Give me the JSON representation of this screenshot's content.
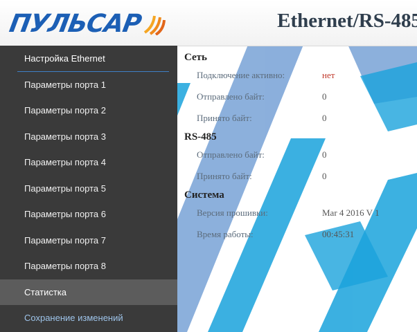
{
  "header": {
    "logo_text": "ПУЛЬСАР",
    "title": "Ethernet/RS-485"
  },
  "sidebar": {
    "items": [
      {
        "label": "Настройка Ethernet"
      },
      {
        "label": "Параметры порта 1"
      },
      {
        "label": "Параметры порта 2"
      },
      {
        "label": "Параметры порта 3"
      },
      {
        "label": "Параметры порта 4"
      },
      {
        "label": "Параметры порта 5"
      },
      {
        "label": "Параметры порта 6"
      },
      {
        "label": "Параметры порта 7"
      },
      {
        "label": "Параметры порта 8"
      },
      {
        "label": "Статистка"
      },
      {
        "label": "Сохранение изменений"
      }
    ],
    "active_index": 9
  },
  "stats": {
    "network": {
      "title": "Сеть",
      "connection_label": "Подключение активно:",
      "connection_value": "нет",
      "sent_label": "Отправлено байт:",
      "sent_value": "0",
      "received_label": "Принято байт:",
      "received_value": "0"
    },
    "rs485": {
      "title": "RS-485",
      "sent_label": "Отправлено байт:",
      "sent_value": "0",
      "received_label": "Принято байт:",
      "received_value": "0"
    },
    "system": {
      "title": "Система",
      "firmware_label": "Версия прошивки:",
      "firmware_value": "Mar 4 2016 V 1",
      "uptime_label": "Время работы:",
      "uptime_value": "00:45:31"
    }
  },
  "colors": {
    "brand_blue": "#1c5fb5",
    "logo_accent": "#f5a623",
    "sidebar_bg": "#3a3a3a",
    "active_bg": "#5c5c5c",
    "alert_red": "#c0392b",
    "watermark_cyan": "#3ab0e2"
  }
}
